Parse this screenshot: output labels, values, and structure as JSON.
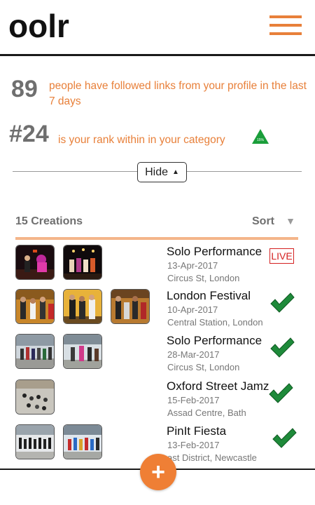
{
  "app": {
    "logo": "oolr",
    "menu_icon": "hamburger-menu-icon"
  },
  "stats": {
    "followers": {
      "value": "89",
      "text": "people have followed links from your profile in the last 7 days"
    },
    "rank": {
      "value": "#24",
      "text": "is your rank within in your category",
      "badge": "15%",
      "badge_color": "#1a9e3a"
    }
  },
  "toggle": {
    "label": "Hide",
    "icon": "triangle-up-icon"
  },
  "list": {
    "count_label": "15 Creations",
    "sort_label": "Sort",
    "sort_icon": "triangle-down-icon",
    "items": [
      {
        "title": "Solo Performance",
        "date": "13-Apr-2017",
        "venue": "Circus St, London",
        "status": "LIVE",
        "status_color": "#d42020"
      },
      {
        "title": "London Festival",
        "date": "10-Apr-2017",
        "venue": "Central Station, London",
        "status": "check-icon"
      },
      {
        "title": "Solo Performance",
        "date": "28-Mar-2017",
        "venue": "Circus St, London",
        "status": "check-icon"
      },
      {
        "title": "Oxford Street Jamz",
        "date": "15-Feb-2017",
        "venue": "Assad Centre, Bath",
        "status": "check-icon"
      },
      {
        "title": "PinIt Fiesta",
        "date": "13-Feb-2017",
        "venue": "ast District, Newcastle",
        "status": "check-icon"
      }
    ]
  },
  "fab": {
    "label": "+"
  },
  "colors": {
    "accent": "#e8803a",
    "check": "#1e8a3a",
    "live": "#d42020"
  }
}
